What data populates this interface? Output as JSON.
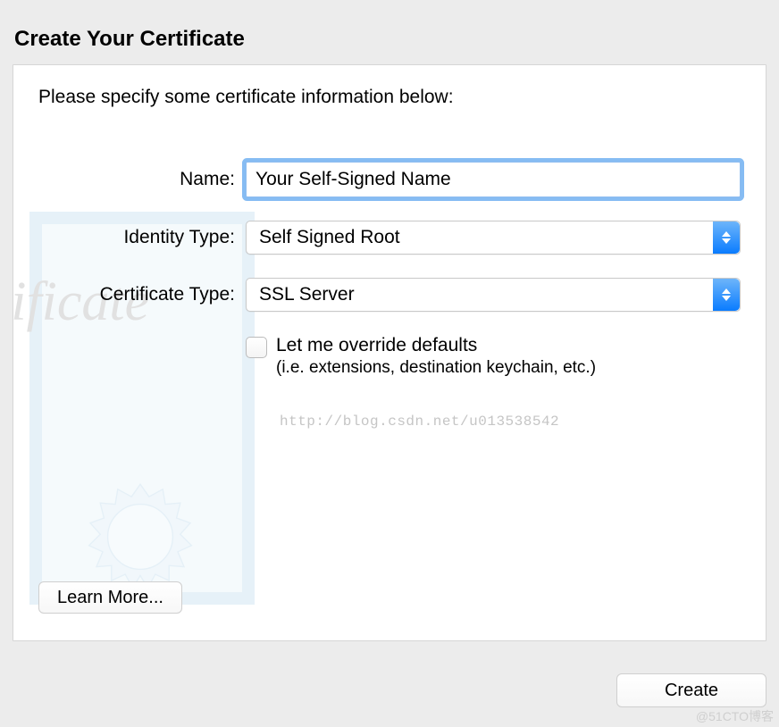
{
  "title": "Create Your Certificate",
  "instruction": "Please specify some certificate information below:",
  "form": {
    "name_label": "Name:",
    "name_value": "Your Self-Signed Name",
    "identity_label": "Identity Type:",
    "identity_value": "Self Signed Root",
    "cert_label": "Certificate Type:",
    "cert_value": "SSL Server",
    "override_label": "Let me override defaults",
    "override_sub": "(i.e. extensions, destination keychain, etc.)",
    "override_checked": false
  },
  "bg_script": "tificate",
  "watermark_url": "http://blog.csdn.net/u013538542",
  "buttons": {
    "learn_more": "Learn More...",
    "create": "Create"
  },
  "corner_mark": "@51CTO博客"
}
